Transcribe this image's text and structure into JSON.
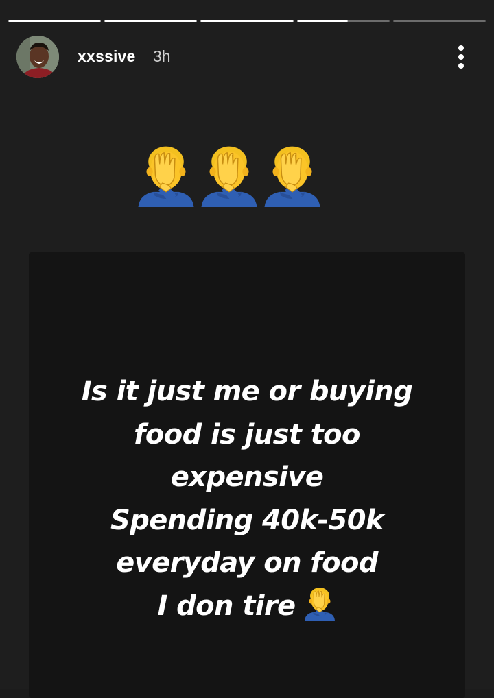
{
  "story": {
    "progress_segments": [
      1,
      1,
      1,
      0.55,
      0
    ],
    "username": "xxssive",
    "timestamp": "3h",
    "more_icon": "more-vertical-icon",
    "avatar_icon": "profile-avatar"
  },
  "decoration": {
    "emoji": "face-palm-icon",
    "emoji_count": 3
  },
  "post": {
    "lines": [
      "Is it just me or buying",
      "food is just too",
      "expensive",
      "Spending 40k-50k",
      "everyday on food",
      "I don tire"
    ],
    "trailing_emoji": "face-palm-icon",
    "background_color": "#141414",
    "text_color": "#ffffff"
  },
  "colors": {
    "screen_bg": "#1e1e1e",
    "progress_active": "#ffffff",
    "progress_inactive": "rgba(255,255,255,0.35)"
  }
}
